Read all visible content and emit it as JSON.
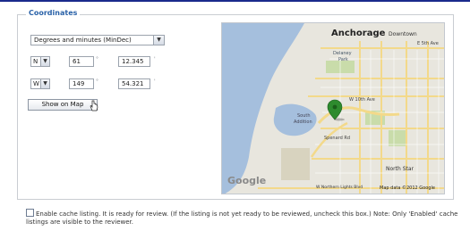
{
  "coordinates": {
    "legend": "Coordinates",
    "format_select": "Degrees and minutes (MinDec)",
    "lat": {
      "hemisphere": "N",
      "degrees": "61",
      "minutes": "12.345"
    },
    "lon": {
      "hemisphere": "W",
      "degrees": "149",
      "minutes": "54.321"
    },
    "degree_symbol": "°",
    "minute_symbol": "'",
    "show_on_map": "Show on Map"
  },
  "map": {
    "city": "Anchorage",
    "downtown": "Downtown",
    "labels": {
      "e_5th": "E 5th Ave",
      "delaney": "Delaney",
      "park": "Park",
      "w_10th": "W 10th Ave",
      "south": "South",
      "addition": "Addition",
      "north_star": "North Star",
      "w_northern_lights": "W Northern Lights Blvd",
      "spenard": "Spenard Rd"
    },
    "google": "Google",
    "map_data": "Map data ©2012 Google",
    "colors": {
      "water": "#a5bfdd",
      "land": "#e8e6de",
      "road": "#f3d98a",
      "park": "#c9dcaa",
      "pin": "#2e8b2e"
    }
  },
  "enable": {
    "text": "Enable cache listing. It is ready for review. (If the listing is not yet ready to be reviewed, uncheck this box.) Note: Only 'Enabled' cache listings are visible to the reviewer."
  }
}
